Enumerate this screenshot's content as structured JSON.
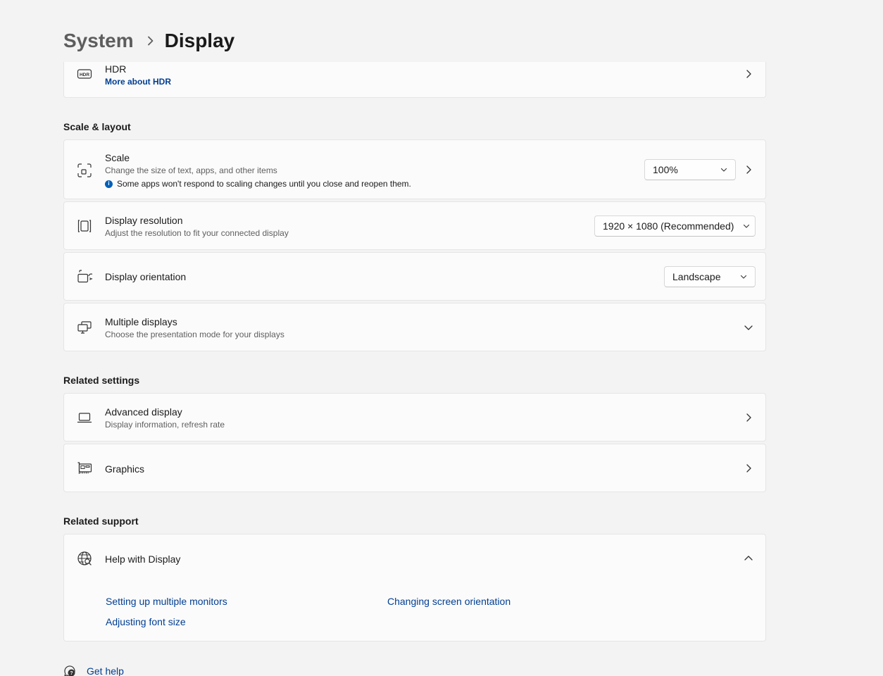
{
  "breadcrumb": {
    "parent": "System",
    "current": "Display"
  },
  "hdr": {
    "title": "HDR",
    "link": "More about HDR",
    "icon": "hdr-icon"
  },
  "scale_layout": {
    "heading": "Scale & layout",
    "scale": {
      "title": "Scale",
      "subtitle": "Change the size of text, apps, and other items",
      "info": "Some apps won't respond to scaling changes until you close and reopen them.",
      "info_glyph": "i",
      "value": "100%",
      "icon": "scale-icon"
    },
    "resolution": {
      "title": "Display resolution",
      "subtitle": "Adjust the resolution to fit your connected display",
      "value": "1920 × 1080 (Recommended)",
      "icon": "resolution-icon"
    },
    "orientation": {
      "title": "Display orientation",
      "value": "Landscape",
      "icon": "orientation-icon"
    },
    "multiple": {
      "title": "Multiple displays",
      "subtitle": "Choose the presentation mode for your displays",
      "icon": "multiple-displays-icon"
    }
  },
  "related_settings": {
    "heading": "Related settings",
    "advanced": {
      "title": "Advanced display",
      "subtitle": "Display information, refresh rate",
      "icon": "laptop-icon"
    },
    "graphics": {
      "title": "Graphics",
      "icon": "graphics-card-icon"
    }
  },
  "related_support": {
    "heading": "Related support",
    "help": {
      "title": "Help with Display",
      "icon": "globe-search-icon"
    },
    "links": [
      "Setting up multiple monitors",
      "Changing screen orientation",
      "Adjusting font size"
    ]
  },
  "footer": {
    "get_help": "Get help",
    "icon": "get-help-icon"
  },
  "colors": {
    "background": "#f3f3f3",
    "card": "#fbfbfb",
    "border": "#e5e5e5",
    "link": "#003e92",
    "accent": "#005fb8"
  }
}
